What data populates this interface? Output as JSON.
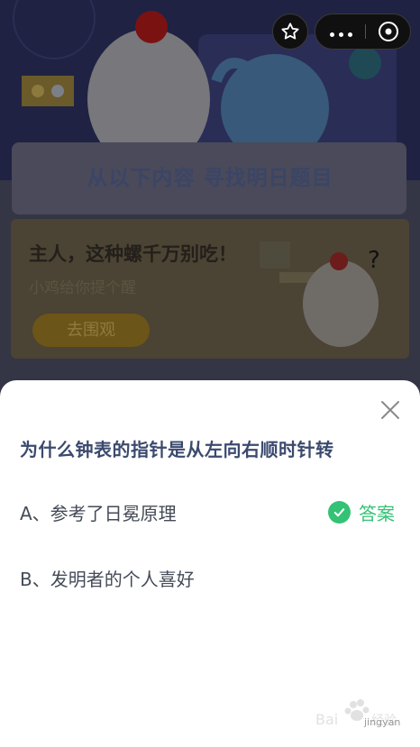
{
  "background": {
    "headline": "从以下内容 寻找明日题目",
    "promo": {
      "title": "主人，这种螺千万别吃！",
      "subtitle": "小鸡给你提个醒",
      "button_label": "去围观"
    }
  },
  "capsule": {
    "star_icon": "star-icon",
    "more_icon": "more-dots-icon",
    "close_icon": "close-circle-icon"
  },
  "sheet": {
    "question": "为什么钟表的指针是从左向右顺时针转",
    "options": [
      {
        "label": "A、参考了日冕原理",
        "is_answer": true,
        "answer_label": "答案"
      },
      {
        "label": "B、发明者的个人喜好",
        "is_answer": false
      }
    ]
  },
  "watermark": {
    "text": "jingyan"
  },
  "colors": {
    "accent_green": "#34c275",
    "question_text": "#3b4a6e",
    "overlay": "#1f2242"
  }
}
